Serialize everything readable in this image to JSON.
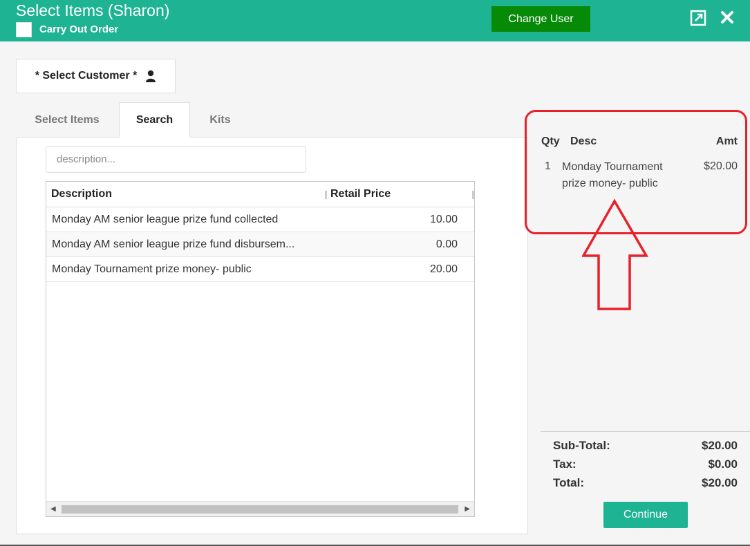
{
  "header": {
    "title": "Select Items (Sharon)",
    "carry_out_label": "Carry Out Order",
    "change_user_label": "Change User",
    "background_color": "#1db393",
    "change_user_color": "#078a07"
  },
  "customer": {
    "label": "* Select Customer *"
  },
  "tabs": [
    {
      "label": "Select Items",
      "active": false
    },
    {
      "label": "Search",
      "active": true
    },
    {
      "label": "Kits",
      "active": false
    }
  ],
  "search": {
    "value": "",
    "placeholder": "description..."
  },
  "grid": {
    "columns": [
      "Description",
      "Retail Price"
    ],
    "rows": [
      {
        "description": "Monday AM senior league prize fund collected",
        "price": "10.00"
      },
      {
        "description": "Monday AM senior league prize fund disbursem...",
        "price": "0.00"
      },
      {
        "description": "Monday Tournament prize money- public",
        "price": "20.00"
      }
    ]
  },
  "cart": {
    "headers": {
      "qty": "Qty",
      "desc": "Desc",
      "amt": "Amt"
    },
    "items": [
      {
        "qty": "1",
        "desc": "Monday Tournament prize money- public",
        "amt": "$20.00"
      }
    ]
  },
  "totals": {
    "subtotal_label": "Sub-Total:",
    "subtotal": "$20.00",
    "tax_label": "Tax:",
    "tax": "$0.00",
    "total_label": "Total:",
    "total": "$20.00"
  },
  "continue_label": "Continue",
  "annotation": {
    "color": "#e8202a"
  }
}
